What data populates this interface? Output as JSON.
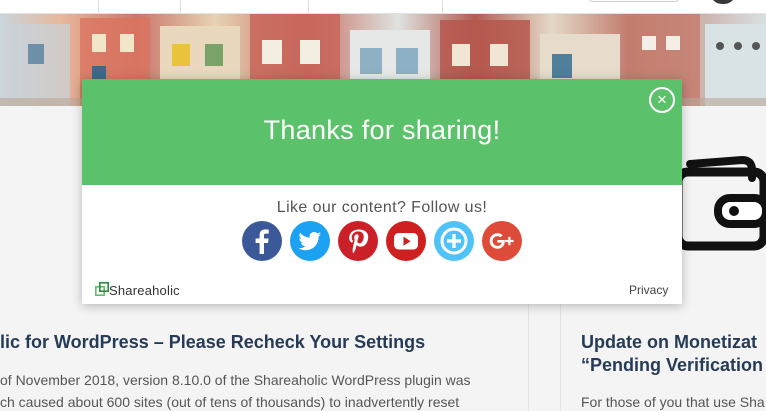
{
  "modal": {
    "title": "Thanks for sharing!",
    "follow_prompt": "Like our content? Follow us!",
    "close_label": "×",
    "brand_name": "Shareaholic",
    "privacy_label": "Privacy",
    "social_buttons": [
      {
        "name": "facebook",
        "color": "#3b5998"
      },
      {
        "name": "twitter",
        "color": "#1da1f2"
      },
      {
        "name": "pinterest",
        "color": "#cb2027"
      },
      {
        "name": "youtube",
        "color": "#cd201f"
      },
      {
        "name": "shareaholic-follow",
        "color": "#4fc3f7"
      },
      {
        "name": "google-plus",
        "color": "#dd4b39"
      }
    ]
  },
  "articles": [
    {
      "title": "lic for WordPress – Please Recheck Your Settings",
      "lines": [
        "of November 2018, version 8.10.0 of the Shareaholic WordPress plugin was",
        "ch caused about 600 sites (out of tens of thousands) to inadvertently reset"
      ]
    },
    {
      "title_lines": [
        "Update on Monetizat",
        "“Pending Verification"
      ],
      "lines": [
        "For those of you that use Sha"
      ]
    }
  ],
  "colors": {
    "modal_green": "#5cc16b",
    "title_navy": "#263b57"
  }
}
